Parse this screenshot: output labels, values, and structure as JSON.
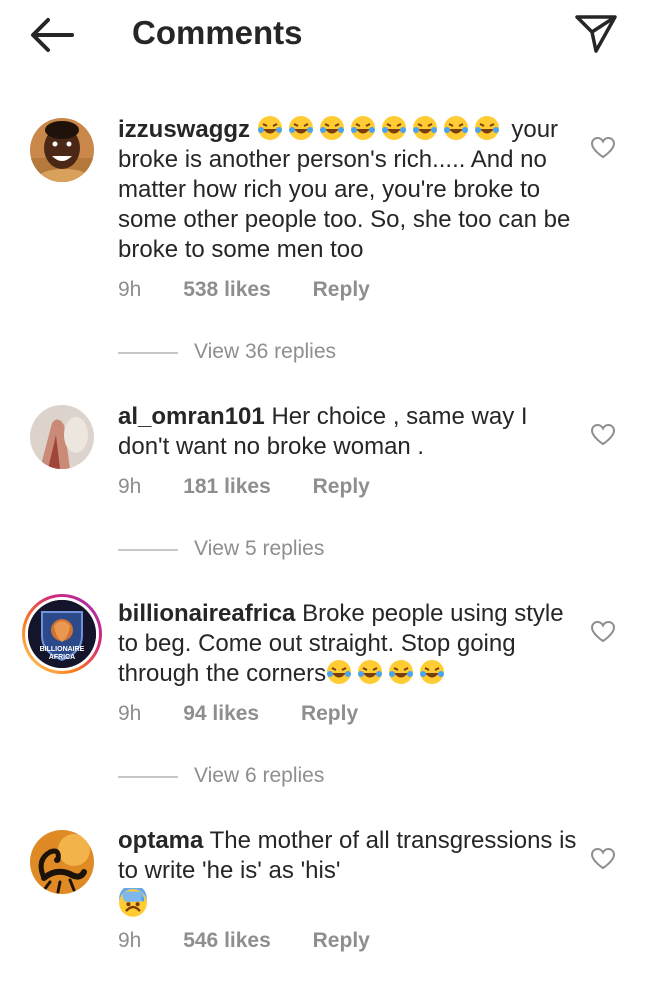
{
  "header": {
    "title": "Comments",
    "back_icon": "arrow-left-icon",
    "send_icon": "paper-plane-icon"
  },
  "comments": [
    {
      "username": "izzuswaggz",
      "text": "your broke is another person's rich..... And no matter how rich you are, you're broke to some other people too. So, she too can be broke to some men too",
      "emoji_count": 8,
      "time": "9h",
      "likes": "538 likes",
      "reply": "Reply",
      "view_replies": "View 36 replies"
    },
    {
      "username": "al_omran101",
      "text": "Her choice , same way I don't want no broke woman .",
      "time": "9h",
      "likes": "181 likes",
      "reply": "Reply",
      "view_replies": "View 5 replies"
    },
    {
      "username": "billionaireafrica",
      "text": "Broke people using style to beg. Come out straight. Stop going through the corners",
      "emoji_count": 4,
      "avatar_text": "BILLIONAIRE AFRICA",
      "time": "9h",
      "likes": "94 likes",
      "reply": "Reply",
      "view_replies": "View 6 replies"
    },
    {
      "username": "optama",
      "text": "The mother of all transgressions is to write 'he is' as 'his'",
      "time": "9h",
      "likes": "546 likes",
      "reply": "Reply"
    }
  ],
  "colors": {
    "text": "#262626",
    "muted": "#8e8e8e",
    "ring_gradient": [
      "#feda75",
      "#d62976",
      "#962fbf"
    ]
  }
}
